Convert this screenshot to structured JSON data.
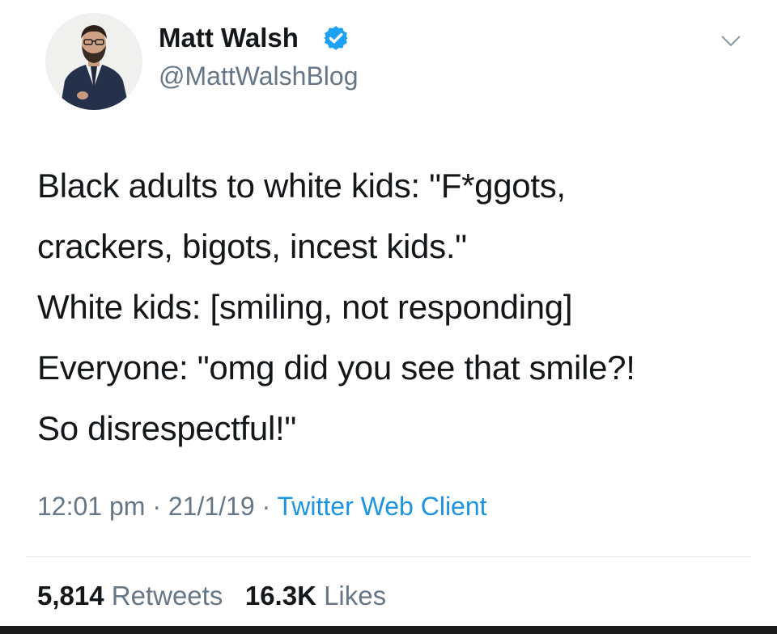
{
  "tweet": {
    "author": {
      "display_name": "Matt Walsh",
      "handle": "@MattWalshBlog",
      "verified": true,
      "avatar_icon": "profile-photo",
      "verified_icon": "verified-badge-icon",
      "verified_color": "#1da1f2"
    },
    "menu_icon": "chevron-down-icon",
    "text_lines": [
      "Black adults to white kids: \"F*ggots,",
      "crackers, bigots, incest kids.\"",
      "White kids: [smiling, not responding]",
      "Everyone: \"omg did you see that smile?!",
      "So disrespectful!\""
    ],
    "time": "12:01 pm",
    "date": "21/1/19",
    "separator": "·",
    "source": "Twitter Web Client",
    "retweets_count": "5,814",
    "retweets_label": "Retweets",
    "likes_count": "16.3K",
    "likes_label": "Likes"
  },
  "colors": {
    "text": "#14171a",
    "secondary_text": "#657786",
    "link": "#1b95e0",
    "divider": "#e1e8ed"
  }
}
